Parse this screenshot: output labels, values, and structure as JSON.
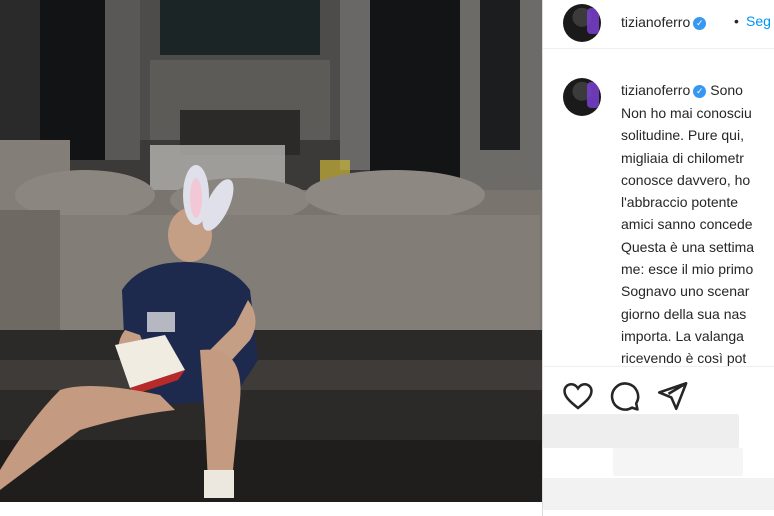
{
  "post": {
    "image_description_icon": "photo-icon",
    "header": {
      "username": "tizianoferro",
      "verified_icon": "verified-badge-icon",
      "separator": "•",
      "follow_label": "Seg"
    },
    "caption": {
      "username": "tizianoferro",
      "lead": "Sono",
      "lines": [
        "Non ho mai conosciu",
        "solitudine. Pure qui,",
        "migliaia di chilometr",
        "conosce davvero, ho",
        "l'abbraccio potente",
        "amici sanno concede",
        "Questa è una settima",
        "me: esce il mio primo",
        "Sognavo uno scenar",
        "giorno della sua nas",
        "importa. La valanga",
        "ricevendo è così pot"
      ]
    },
    "actions": {
      "like_icon": "heart-icon",
      "comment_icon": "comment-icon",
      "share_icon": "send-icon"
    }
  },
  "colors": {
    "link_blue": "#0095f6",
    "verified_blue": "#3897f0",
    "text": "#262626",
    "divider": "#efefef"
  }
}
